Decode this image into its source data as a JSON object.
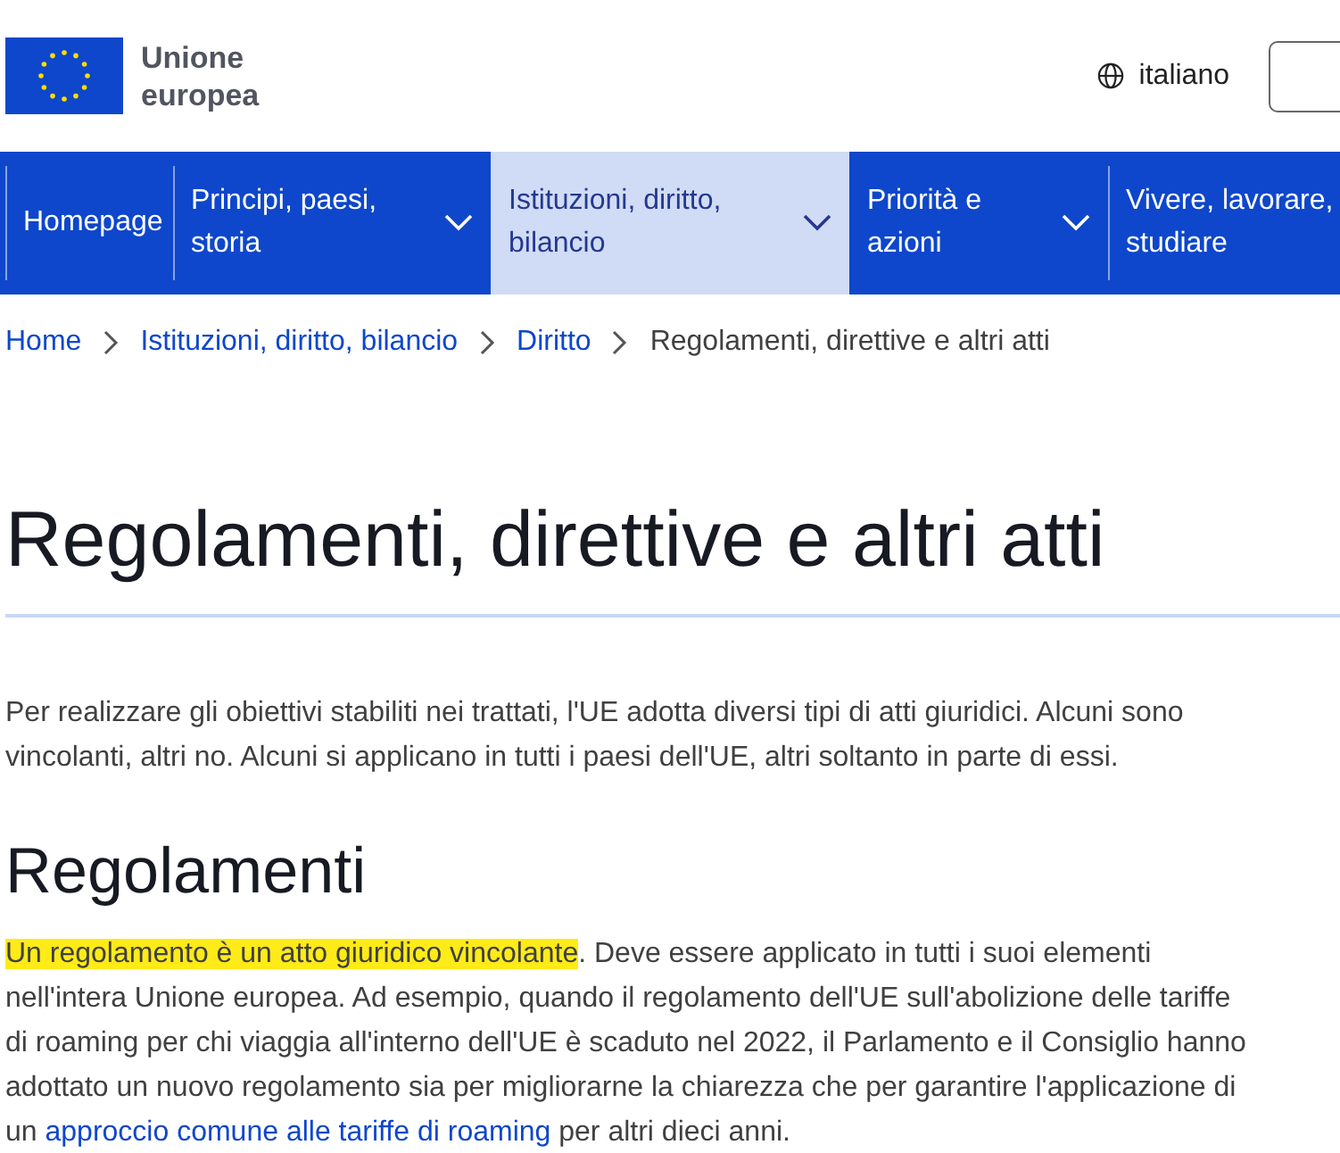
{
  "header": {
    "logo_text": "Unione europea",
    "language": "italiano"
  },
  "nav": [
    {
      "label": "Homepage",
      "selected": false,
      "expandable": false
    },
    {
      "label": "Principi, paesi, storia",
      "selected": false,
      "expandable": true
    },
    {
      "label": "Istituzioni, diritto, bilancio",
      "selected": true,
      "expandable": true
    },
    {
      "label": "Priorità e azioni",
      "selected": false,
      "expandable": true
    },
    {
      "label": "Vivere, lavorare, studiare",
      "selected": false,
      "expandable": false
    }
  ],
  "breadcrumb": [
    {
      "label": "Home",
      "current": false
    },
    {
      "label": "Istituzioni, diritto, bilancio",
      "current": false
    },
    {
      "label": "Diritto",
      "current": false
    },
    {
      "label": "Regolamenti, direttive e altri atti",
      "current": true
    }
  ],
  "title": "Regolamenti, direttive e altri atti",
  "intro": "Per realizzare gli obiettivi stabiliti nei trattati, l'UE adotta diversi tipi di atti giuridici. Alcuni sono vincolanti, altri no. Alcuni si applicano in tutti i paesi dell'UE, altri soltanto in parte di essi.",
  "section": {
    "heading": "Regolamenti",
    "paragraph": [
      {
        "kind": "highlight",
        "text": "Un regolamento è un atto giuridico vincolante"
      },
      {
        "kind": "plain",
        "text": ". Deve essere applicato in tutti i suoi elementi nell'intera Unione europea. Ad esempio, quando il regolamento dell'UE sull'abolizione delle tariffe di roaming per chi viaggia all'interno dell'UE è scaduto nel 2022, il Parlamento e il Consiglio hanno adottato un nuovo regolamento sia per migliorarne la chiarezza che per garantire l'applicazione di un "
      },
      {
        "kind": "link",
        "text": "approccio comune alle tariffe di roaming"
      },
      {
        "kind": "plain",
        "text": " per altri dieci anni."
      }
    ]
  }
}
